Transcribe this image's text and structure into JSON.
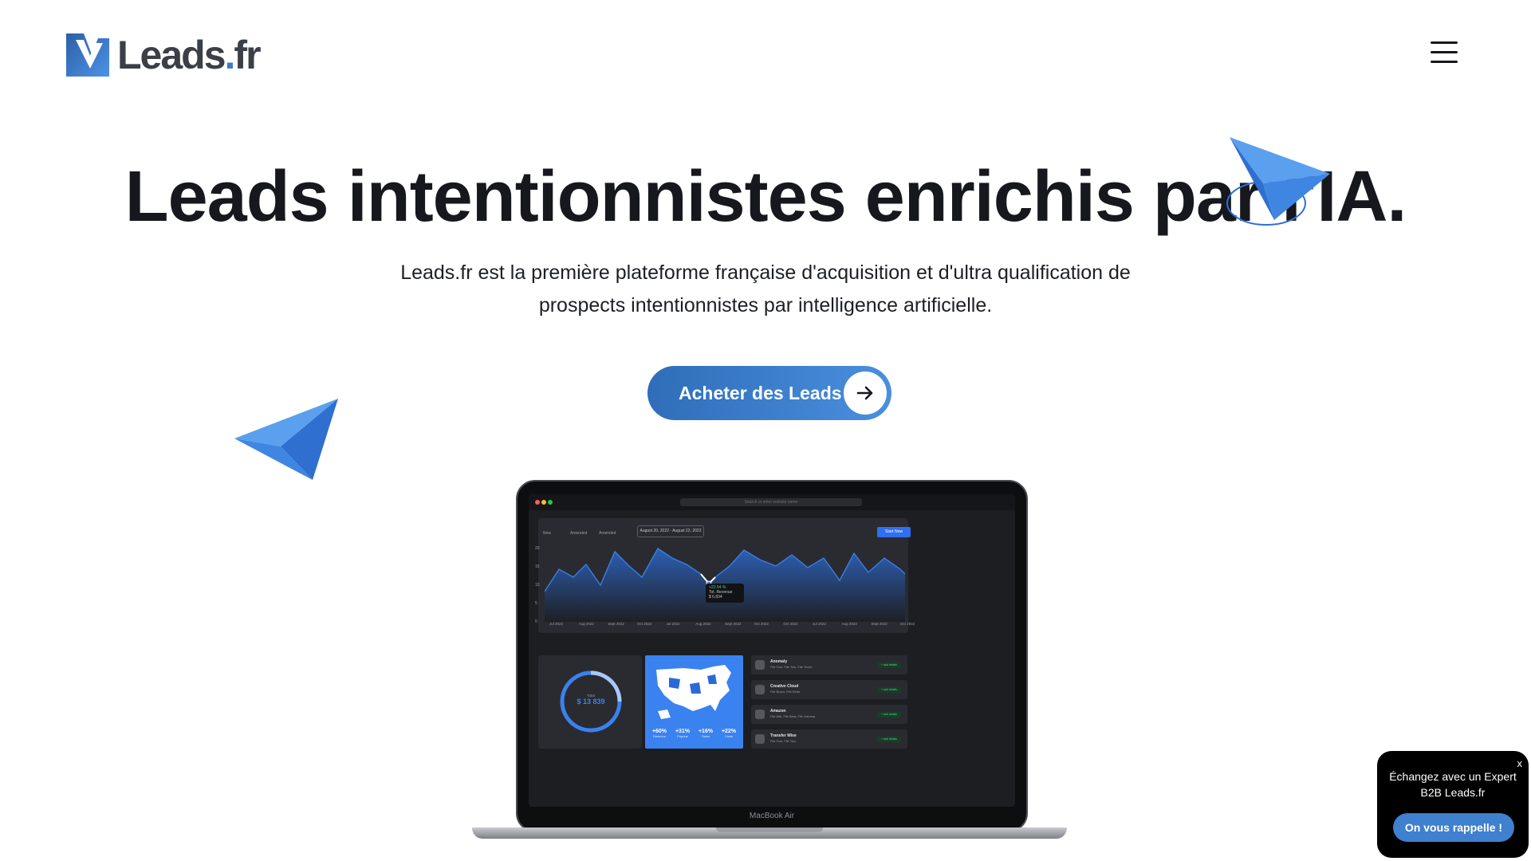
{
  "header": {
    "logo_text": "Leads",
    "logo_dot": ".",
    "logo_suffix": "fr",
    "menu_icon": "hamburger-menu-icon"
  },
  "hero": {
    "title": "Leads intentionnistes enrichis par l'IA.",
    "subtitle_line1": "Leads.fr est la première plateforme française d'acquisition et d'ultra qualification de",
    "subtitle_line2": "prospects intentionnistes par intelligence artificielle.",
    "cta_label": "Acheter des Leads",
    "cta_icon": "arrow-right-icon"
  },
  "decorations": {
    "plane_icon": "paper-plane-icon",
    "accent": "#3b82e0"
  },
  "laptop": {
    "label": "MacBook Air",
    "browser": {
      "url_placeholder": "Search or enter website name"
    },
    "dashboard": {
      "filters": [
        "New",
        "Amended",
        "Amended"
      ],
      "date_range": "August 20, 2022 - August 22, 2022",
      "start_button": "Start Now",
      "y_ticks": [
        "20",
        "15",
        "10",
        "5",
        "0"
      ],
      "x_ticks": [
        "Jul 2022",
        "Aug 2022",
        "Sept 2022",
        "Oct 2022",
        "Jul 2022",
        "Aug 2022",
        "Sept 2022",
        "Oct 2022",
        "Oct 2022",
        "Jul 2022",
        "Aug 2022",
        "Sept 2022",
        "Oct 2022"
      ],
      "tooltip": {
        "change": "+22.54 %",
        "label": "Tot. Revenue",
        "value": "$ 6,834"
      },
      "total": {
        "label": "Total",
        "value": "$ 13 839"
      },
      "stats": [
        {
          "value": "+60%",
          "label": "Revenue"
        },
        {
          "value": "+31%",
          "label": "Popular"
        },
        {
          "value": "+16%",
          "label": "Sales"
        },
        {
          "value": "+22%",
          "label": "Costs"
        }
      ],
      "rows": [
        {
          "title": "Anomaly",
          "subtitle": "File One, File Two, File Three",
          "badge": "+ add details"
        },
        {
          "title": "Creative Cloud",
          "subtitle": "File Bravo, File Delta",
          "badge": "+ add details"
        },
        {
          "title": "Amazon",
          "subtitle": "File Alfa, File Beta, File Gamma",
          "badge": "+ add details"
        },
        {
          "title": "Transfer Wise",
          "subtitle": "File One, File Two",
          "badge": "+ add details"
        }
      ]
    }
  },
  "chat_widget": {
    "close": "x",
    "text_line1": "Échangez avec un Expert",
    "text_line2": "B2B Leads.fr",
    "button": "On vous rappelle !"
  }
}
